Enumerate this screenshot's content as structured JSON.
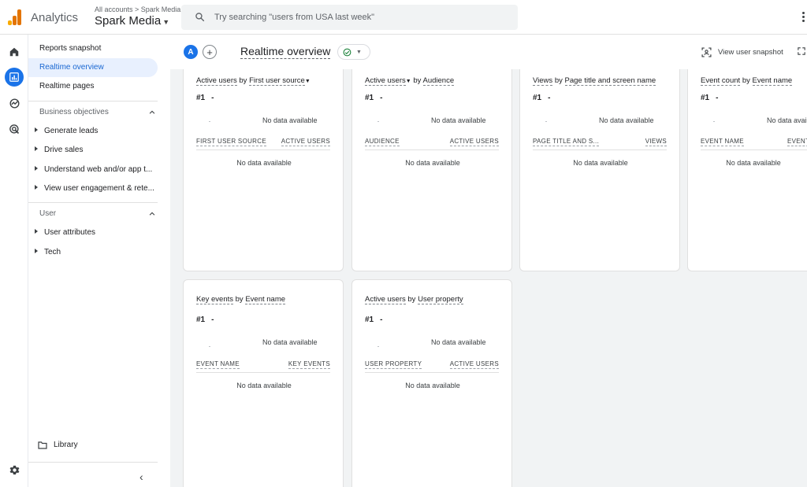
{
  "app": {
    "name": "Analytics",
    "account_crumb": "All accounts > Spark Media",
    "property": "Spark Media",
    "logo_colors": [
      "#f9ab00",
      "#e37400",
      "#e37400"
    ]
  },
  "search": {
    "placeholder": "Try searching \"users from USA last week\""
  },
  "rail": [
    {
      "icon": "home-icon"
    },
    {
      "icon": "reports-icon",
      "active": true
    },
    {
      "icon": "explore-icon"
    },
    {
      "icon": "advertising-icon"
    }
  ],
  "sidebar": {
    "items": [
      {
        "label": "Reports snapshot"
      },
      {
        "label": "Realtime overview",
        "active": true
      },
      {
        "label": "Realtime pages"
      }
    ],
    "sections": [
      {
        "label": "Business objectives",
        "items": [
          {
            "label": "Generate leads"
          },
          {
            "label": "Drive sales"
          },
          {
            "label": "Understand web and/or app t..."
          },
          {
            "label": "View user engagement & rete..."
          }
        ]
      },
      {
        "label": "User",
        "items": [
          {
            "label": "User attributes"
          },
          {
            "label": "Tech"
          }
        ]
      }
    ],
    "library": "Library"
  },
  "header": {
    "avatar": "A",
    "add": "+",
    "title": "Realtime overview",
    "snapshot_label": "View user snapshot"
  },
  "cards": [
    {
      "metric": "Active users",
      "by": "by",
      "dimension": "First user source",
      "has_dropdown": true,
      "rank": "#1",
      "rank_value": "-",
      "no_data": "No data available",
      "col1": "FIRST USER SOURCE",
      "col2": "ACTIVE USERS",
      "no_data_table": "No data available"
    },
    {
      "metric": "Active users",
      "by": "by",
      "dimension": "Audience",
      "has_dropdown": true,
      "rank": "#1",
      "rank_value": "-",
      "no_data": "No data available",
      "col1": "AUDIENCE",
      "col2": "ACTIVE USERS",
      "no_data_table": "No data available"
    },
    {
      "metric": "Views",
      "by": "by",
      "dimension": "Page title and screen name",
      "rank": "#1",
      "rank_value": "-",
      "no_data": "No data available",
      "col1": "PAGE TITLE AND S...",
      "col2": "VIEWS",
      "no_data_table": "No data available"
    },
    {
      "metric": "Event count",
      "by": "by",
      "dimension": "Event name",
      "rank": "#1",
      "rank_value": "-",
      "no_data": "No data available",
      "col1": "EVENT NAME",
      "col2": "EVENT COUNT",
      "no_data_table": "No data available"
    },
    {
      "metric": "Key events",
      "by": "by",
      "dimension": "Event name",
      "rank": "#1",
      "rank_value": "-",
      "no_data": "No data available",
      "col1": "EVENT NAME",
      "col2": "KEY EVENTS",
      "no_data_table": "No data available"
    },
    {
      "metric": "Active users",
      "by": "by",
      "dimension": "User property",
      "rank": "#1",
      "rank_value": "-",
      "no_data": "No data available",
      "col1": "USER PROPERTY",
      "col2": "ACTIVE USERS",
      "no_data_table": "No data available"
    }
  ],
  "colors": {
    "accent": "#1a73e8",
    "active_nav_bg": "#e8f0fe",
    "status_ok": "#188038"
  }
}
